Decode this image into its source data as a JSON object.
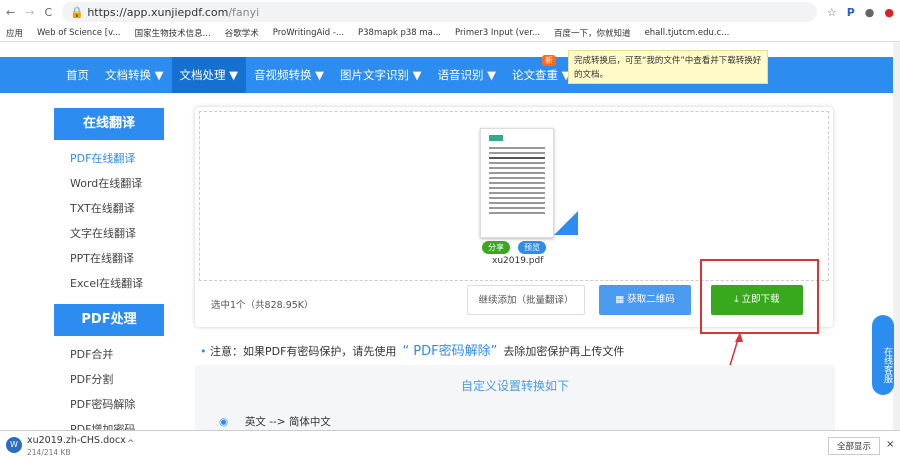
{
  "browser": {
    "url_host": "https://app.xunjiepdf.com",
    "url_path": "/fanyi",
    "bookmarks": [
      "应用",
      "Web of Science [v...",
      "国家生物技术信息...",
      "谷歌学术",
      "ProWritingAid -...",
      "P38mapk p38 ma...",
      "Primer3 Input (ver...",
      "百度一下，你就知道",
      "ehall.tjutcm.edu.c..."
    ]
  },
  "nav": {
    "items": [
      "首页",
      "文档转换 ▼",
      "文档处理 ▼",
      "音视频转换 ▼",
      "图片文字识别 ▼",
      "语音识别 ▼",
      "论文查重 ▼"
    ],
    "badge": "新",
    "tooltip": "完成转换后，可至“我的文件”中查看并下载转换好的文档。"
  },
  "sidebar": {
    "sections": [
      {
        "title": "在线翻译",
        "items": [
          "PDF在线翻译",
          "Word在线翻译",
          "TXT在线翻译",
          "文字在线翻译",
          "PPT在线翻译",
          "Excel在线翻译"
        ]
      },
      {
        "title": "PDF处理",
        "items": [
          "PDF合并",
          "PDF分割",
          "PDF密码解除",
          "PDF增加密码"
        ]
      }
    ]
  },
  "file": {
    "name": "xu2019.pdf",
    "share": "分享",
    "preview": "预览"
  },
  "actions": {
    "selected": "选中1个（共828.95K）",
    "add_more": "继续添加（批量翻译）",
    "qr": "获取二维码",
    "download": "立即下载"
  },
  "notice": {
    "prefix": "注意：如果PDF有密码保护，请先使用",
    "link": "“ PDF密码解除”",
    "suffix": "去除加密保护再上传文件"
  },
  "settings": {
    "title": "自定义设置转换如下",
    "option": "英文 --> 简体中文"
  },
  "side_float": "在线客服",
  "downloads": {
    "file": "xu2019.zh-CHS.docx",
    "size": "214/214 KB",
    "show_all": "全部显示"
  }
}
